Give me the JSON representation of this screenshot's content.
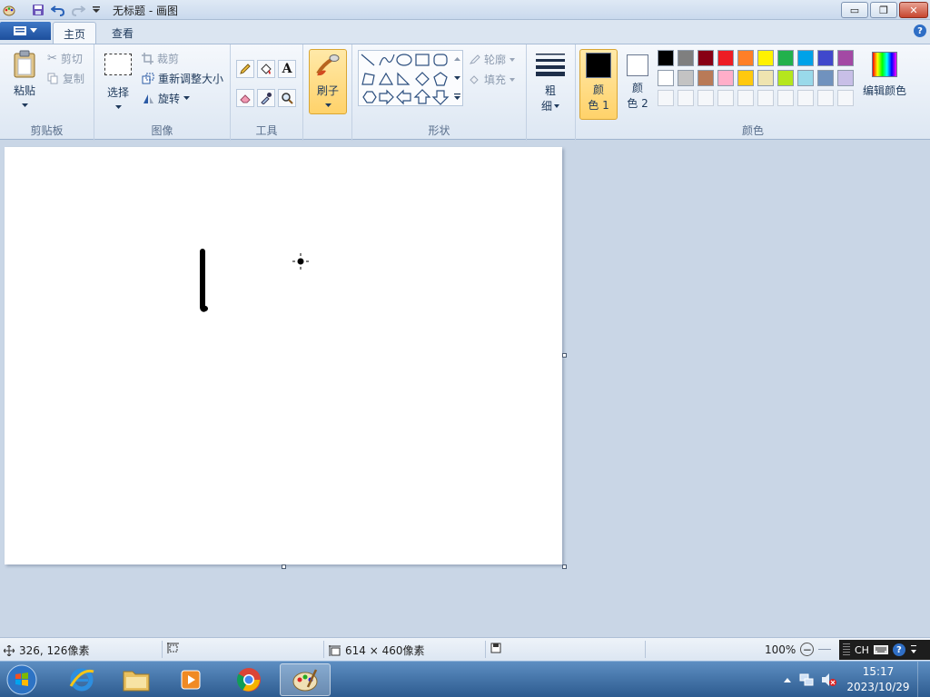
{
  "window": {
    "title": "无标题 - 画图",
    "minimize_glyph": "▭",
    "restore_glyph": "❐",
    "close_glyph": "✕"
  },
  "tabs": {
    "home": "主页",
    "view": "查看"
  },
  "clipboard": {
    "group_label": "剪贴板",
    "paste_label": "粘贴",
    "cut_label": "剪切",
    "copy_label": "复制"
  },
  "image": {
    "group_label": "图像",
    "select_label": "选择",
    "crop_label": "裁剪",
    "resize_label": "重新调整大小",
    "rotate_label": "旋转"
  },
  "tools": {
    "group_label": "工具",
    "text_glyph": "A"
  },
  "brushes": {
    "label": "刷子"
  },
  "shapes": {
    "group_label": "形状",
    "outline_label": "轮廓",
    "fill_label": "填充"
  },
  "size": {
    "label_line1": "粗",
    "label_line2": "细"
  },
  "colors": {
    "group_label": "颜色",
    "color1_line1": "颜",
    "color1_line2": "色 1",
    "color2_line1": "颜",
    "color2_line2": "色 2",
    "edit_colors_label": "编辑颜色",
    "color1_value": "#000000",
    "color2_value": "#ffffff",
    "palette_row1": [
      "#000000",
      "#7f7f7f",
      "#880015",
      "#ed1c24",
      "#ff7f27",
      "#fff200",
      "#22b14c",
      "#00a2e8",
      "#3f48cc",
      "#a349a4"
    ],
    "palette_row2": [
      "#ffffff",
      "#c3c3c3",
      "#b97a57",
      "#ffaec9",
      "#ffc90e",
      "#efe4b0",
      "#b5e61d",
      "#99d9ea",
      "#7092be",
      "#c8bfe7"
    ]
  },
  "status": {
    "cursor_position": "326, 126像素",
    "canvas_size": "614 × 460像素",
    "zoom": "100%"
  },
  "langbar": {
    "lang": "CH",
    "help_glyph": "?"
  },
  "taskbar": {
    "time": "15:17",
    "date": "2023/10/29"
  }
}
